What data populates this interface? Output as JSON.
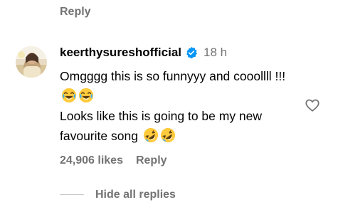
{
  "previous_comment": {
    "reply_label": "Reply"
  },
  "comment": {
    "username": "keerthysureshofficial",
    "verified": true,
    "timestamp": "18 h",
    "line1": "Omgggg this is so funnyyy and cooollll !!!",
    "line1_emojis": [
      "face-with-tears-of-joy",
      "face-with-tears-of-joy"
    ],
    "line2": "Looks like this is going to be my new favourite song",
    "line2_emojis": [
      "rolling-on-the-floor-laughing",
      "rolling-on-the-floor-laughing"
    ],
    "likes_label": "24,906 likes",
    "reply_label": "Reply",
    "like_icon": "heart-outline-icon"
  },
  "replies": {
    "toggle_label": "Hide all replies"
  },
  "colors": {
    "text": "#000000",
    "secondary": "#737373",
    "verified_blue": "#0095f6",
    "divider": "#c7c7c7"
  }
}
